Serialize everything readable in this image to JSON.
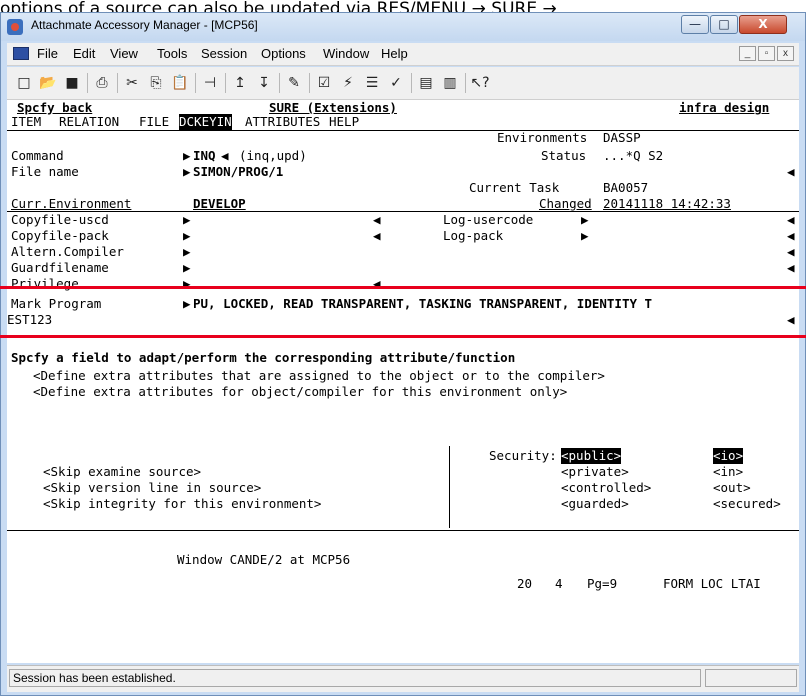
{
  "caption": {
    "text": "options of a source can also be updated via RES/MENU → SURE →"
  },
  "window": {
    "title": "Attachmate Accessory Manager - [MCP56]"
  },
  "window_buttons": {
    "minimize": "—",
    "maximize": "□",
    "close": "X"
  },
  "menu": {
    "items": [
      "File",
      "Edit",
      "View",
      "Tools",
      "Session",
      "Options",
      "Window",
      "Help"
    ]
  },
  "mdi_buttons": {
    "minimize": "_",
    "restore": "▫",
    "close": "x"
  },
  "screen": {
    "header_left": "Spcfy back",
    "header_center": "SURE (Extensions)",
    "header_right": "infra design",
    "tabs": [
      "ITEM",
      "RELATION",
      "FILE",
      "DCKEYIN",
      "ATTRIBUTES",
      "HELP"
    ],
    "active_tab": "DCKEYIN",
    "environments_label": "Environments",
    "environments_value": "DASSP",
    "command_label": "Command",
    "command_value": "INQ",
    "command_hint": "(inq,upd)",
    "status_label": "Status",
    "status_value": "...*Q S2",
    "filename_label": "File name",
    "filename_value": "SIMON/PROG/1",
    "current_task_label": "Current Task",
    "current_task_value": "BA0057",
    "curr_env_label": "Curr.Environment",
    "curr_env_value": "DEVELOP",
    "changed_label": "Changed",
    "changed_value": "20141118 14:42:33",
    "fields_left": [
      "Copyfile-uscd",
      "Copyfile-pack",
      "Altern.Compiler",
      "Guardfilename",
      "Privilege"
    ],
    "fields_right": [
      "Log-usercode",
      "Log-pack"
    ],
    "mark_program_label": "Mark Program",
    "mark_program_value_line1": "PU, LOCKED, READ TRANSPARENT, TASKING TRANSPARENT, IDENTITY T",
    "mark_program_value_line2": "EST123",
    "instruction": "Spcfy a field to adapt/perform the corresponding attribute/function",
    "option1": "<Define extra attributes that are assigned to the object or to the compiler>",
    "option2": "<Define extra attributes for object/compiler for this environment only>",
    "security_label": "Security:",
    "security_options": [
      "<public>",
      "<private>",
      "<controlled>",
      "<guarded>"
    ],
    "io_options": [
      "<io>",
      "<in>",
      "<out>",
      "<secured>"
    ],
    "skip1": "<Skip examine source>",
    "skip2": "<Skip version line in source>",
    "skip3": "<Skip integrity for this environment>",
    "footer_window": "Window CANDE/2 at MCP56",
    "footer_row": "20",
    "footer_col": "4",
    "footer_page": "Pg=9",
    "footer_mode": "FORM LOC LTAI"
  },
  "status": {
    "text": "Session has been established."
  }
}
